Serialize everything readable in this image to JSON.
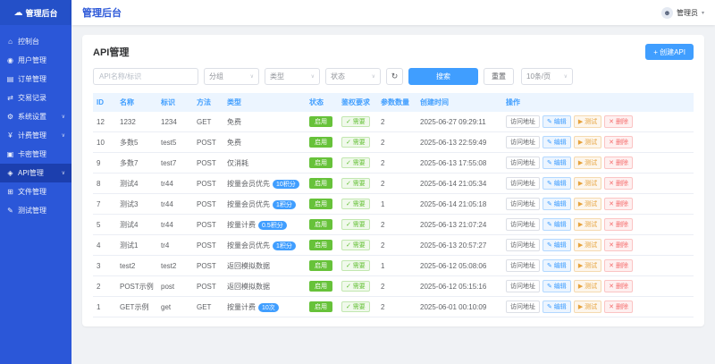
{
  "app": {
    "title": "管理后台",
    "logo_icon": "☁"
  },
  "header": {
    "title": "管理后台",
    "user": {
      "name": "管理员",
      "caret": "▾",
      "avatar_icon": "☻"
    }
  },
  "sidebar": {
    "items": [
      {
        "key": "console",
        "label": "控制台",
        "icon": "⌂",
        "icon_name": "home-icon",
        "expandable": false,
        "active": false
      },
      {
        "key": "users",
        "label": "用户管理",
        "icon": "◉",
        "icon_name": "user-icon",
        "expandable": false,
        "active": false
      },
      {
        "key": "orders",
        "label": "订单管理",
        "icon": "▤",
        "icon_name": "order-icon",
        "expandable": false,
        "active": false
      },
      {
        "key": "transactions",
        "label": "交易记录",
        "icon": "⇄",
        "icon_name": "exchange-icon",
        "expandable": false,
        "active": false
      },
      {
        "key": "settings",
        "label": "系统设置",
        "icon": "⚙",
        "icon_name": "gear-icon",
        "expandable": true,
        "active": false
      },
      {
        "key": "billing",
        "label": "计费管理",
        "icon": "¥",
        "icon_name": "money-icon",
        "expandable": true,
        "active": false
      },
      {
        "key": "cards",
        "label": "卡密管理",
        "icon": "▣",
        "icon_name": "card-key-icon",
        "expandable": false,
        "active": false
      },
      {
        "key": "api",
        "label": "API管理",
        "icon": "◈",
        "icon_name": "api-icon",
        "expandable": true,
        "active": true
      },
      {
        "key": "files",
        "label": "文件管理",
        "icon": "⊞",
        "icon_name": "folder-icon",
        "expandable": false,
        "active": false
      },
      {
        "key": "tests",
        "label": "测试管理",
        "icon": "✎",
        "icon_name": "test-icon",
        "expandable": false,
        "active": false
      }
    ]
  },
  "page": {
    "title": "API管理",
    "create_button_label": "+ 创建API",
    "filters": {
      "search_placeholder": "API名称/标识",
      "group_label": "分组",
      "type_label": "类型",
      "status_label": "状态",
      "caret": "∨",
      "refresh_icon": "↻",
      "search_button_label": "搜索",
      "reset_button_label": "重置",
      "page_size_label": "10条/页"
    },
    "table": {
      "columns": [
        "ID",
        "名称",
        "标识",
        "方法",
        "类型",
        "状态",
        "鉴权要求",
        "参数数量",
        "创建时间",
        "操作"
      ],
      "status_label": "启用",
      "auth_icon": "✓",
      "auth_label": "需要",
      "actions": [
        {
          "label": "访问地址",
          "icon": "",
          "style": "default",
          "name": "visit-button"
        },
        {
          "label": "编辑",
          "icon": "✎",
          "style": "primary",
          "name": "edit-button"
        },
        {
          "label": "测试",
          "icon": "▶",
          "style": "warning",
          "name": "test-button"
        },
        {
          "label": "删除",
          "icon": "✕",
          "style": "danger",
          "name": "delete-button"
        }
      ],
      "rows": [
        {
          "id": "12",
          "name": "1232",
          "code": "1234",
          "method": "GET",
          "type": "免费",
          "type_badge": "",
          "status": "启用",
          "auth": "需要",
          "params": "2",
          "created": "2025-06-27 09:29:11"
        },
        {
          "id": "10",
          "name": "多数5",
          "code": "test5",
          "method": "POST",
          "type": "免费",
          "type_badge": "",
          "status": "启用",
          "auth": "需要",
          "params": "2",
          "created": "2025-06-13 22:59:49"
        },
        {
          "id": "9",
          "name": "多数7",
          "code": "test7",
          "method": "POST",
          "type": "仅消耗",
          "type_badge": "",
          "status": "启用",
          "auth": "需要",
          "params": "2",
          "created": "2025-06-13 17:55:08"
        },
        {
          "id": "8",
          "name": "测试4",
          "code": "tr44",
          "method": "POST",
          "type": "按量会员优先",
          "type_badge": "10积分",
          "status": "启用",
          "auth": "需要",
          "params": "2",
          "created": "2025-06-14 21:05:34"
        },
        {
          "id": "7",
          "name": "测试3",
          "code": "tr44",
          "method": "POST",
          "type": "按量会员优先",
          "type_badge": "1积分",
          "status": "启用",
          "auth": "需要",
          "params": "1",
          "created": "2025-06-14 21:05:18"
        },
        {
          "id": "5",
          "name": "测试4",
          "code": "tr44",
          "method": "POST",
          "type": "按量计费",
          "type_badge": "0.5积分",
          "status": "启用",
          "auth": "需要",
          "params": "2",
          "created": "2025-06-13 21:07:24"
        },
        {
          "id": "4",
          "name": "测试1",
          "code": "tr4",
          "method": "POST",
          "type": "按量会员优先",
          "type_badge": "1积分",
          "status": "启用",
          "auth": "需要",
          "params": "2",
          "created": "2025-06-13 20:57:27"
        },
        {
          "id": "3",
          "name": "test2",
          "code": "test2",
          "method": "POST",
          "type": "返回模拟数据",
          "type_badge": "",
          "status": "启用",
          "auth": "需要",
          "params": "1",
          "created": "2025-06-12 05:08:06"
        },
        {
          "id": "2",
          "name": "POST示例",
          "code": "post",
          "method": "POST",
          "type": "返回模拟数据",
          "type_badge": "",
          "status": "启用",
          "auth": "需要",
          "params": "2",
          "created": "2025-06-12 05:15:16"
        },
        {
          "id": "1",
          "name": "GET示例",
          "code": "get",
          "method": "GET",
          "type": "按量计费",
          "type_badge": "10次",
          "status": "启用",
          "auth": "需要",
          "params": "2",
          "created": "2025-06-01 00:10:09"
        }
      ]
    }
  }
}
